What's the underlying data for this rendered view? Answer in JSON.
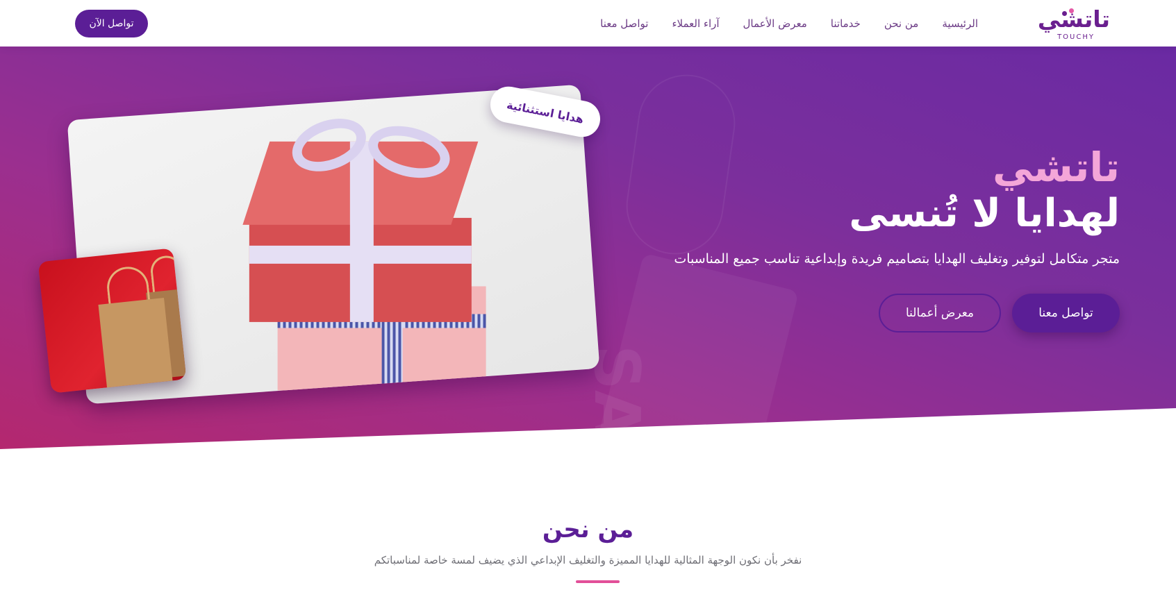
{
  "nav": {
    "logo_ar": "تاتشي",
    "logo_en": "TOUCHY",
    "links": [
      "الرئيسية",
      "من نحن",
      "خدماتنا",
      "معرض الأعمال",
      "آراء العملاء",
      "تواصل معنا"
    ],
    "cta": "تواصل الآن"
  },
  "hero": {
    "title_1": "تاتشي",
    "title_2": "لهدايا لا تُنسى",
    "subtitle": "متجر متكامل لتوفير وتغليف الهدايا بتصاميم فريدة وإبداعية تناسب جميع المناسبات",
    "btn_primary": "تواصل معنا",
    "btn_secondary": "معرض أعمالنا",
    "badge": "هدايا استثنائية",
    "bg_text": "SA"
  },
  "about": {
    "title": "من نحن",
    "text": "نفخر بأن نكون الوجهة المثالية للهدايا المميزة والتغليف الإبداعي الذي يضيف لمسة خاصة لمناسباتكم"
  },
  "colors": {
    "brand_purple": "#5b1e96",
    "accent_pink": "#f4a6d8",
    "divider_pink": "#e24f98"
  }
}
